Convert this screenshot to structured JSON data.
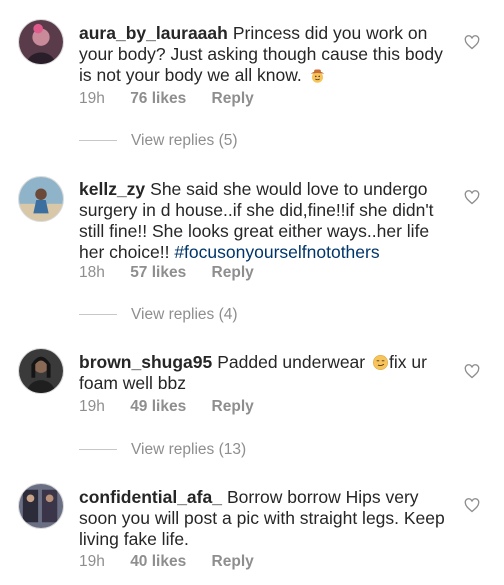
{
  "comments": [
    {
      "username": "aura_by_lauraaah",
      "text": "Princess did you work on your body? Just asking though cause this body is not your body we all know.",
      "emoji": "cowboy-face-emoji",
      "time": "19h",
      "likes": "76 likes",
      "reply": "Reply",
      "view_replies": "View replies (5)"
    },
    {
      "username": "kellz_zy",
      "text": "She said she would love to undergo surgery in d house..if she did,fine!!if she didn't still fine!! She looks great either ways..her life her choice!! ",
      "hashtag": "#focusonyourselfnotothers",
      "time": "18h",
      "likes": "57 likes",
      "reply": "Reply",
      "view_replies": "View replies (4)"
    },
    {
      "username": "brown_shuga95",
      "text_before": "Padded underwear ",
      "emoji": "smirk-emoji",
      "text_after": "fix ur foam well bbz",
      "time": "19h",
      "likes": "49 likes",
      "reply": "Reply",
      "view_replies": "View replies (13)"
    },
    {
      "username": "confidential_afa_",
      "text": "Borrow borrow Hips very soon you will post a pic with straight legs. Keep living fake life.",
      "time": "19h",
      "likes": "40 likes",
      "reply": "Reply"
    }
  ],
  "colors": {
    "text": "#262626",
    "muted": "#8e8e8e",
    "hashtag": "#003569"
  }
}
